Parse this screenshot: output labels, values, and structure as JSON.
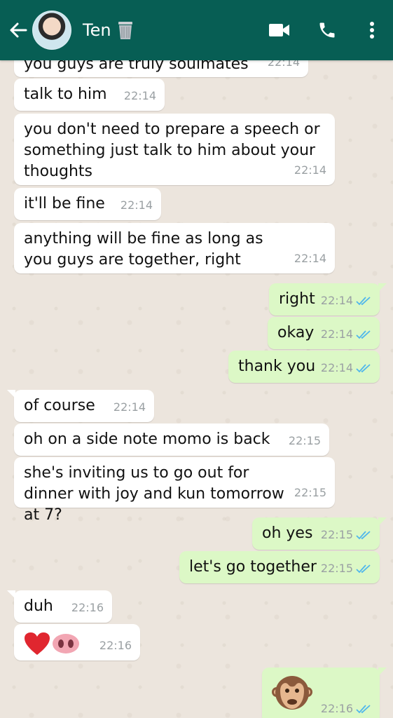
{
  "header": {
    "contact_name": "Ten",
    "name_emoji": "🗑️",
    "bar_color": "#075e54",
    "icons": [
      "back-arrow-icon",
      "video-call-icon",
      "phone-icon",
      "more-options-icon"
    ]
  },
  "colors": {
    "incoming_bubble": "#ffffff",
    "outgoing_bubble": "#dcf8c6",
    "read_ticks": "#4fb6ec",
    "chat_background": "#ece5dd"
  },
  "messages": [
    {
      "text": "you guys are truly soulmates",
      "time": "22:14",
      "dir": "in"
    },
    {
      "text": "talk to him",
      "time": "22:14",
      "dir": "in"
    },
    {
      "text": "you don't need to prepare a speech or something just talk to him about your thoughts",
      "time": "22:14",
      "dir": "in"
    },
    {
      "text": "it'll be fine",
      "time": "22:14",
      "dir": "in"
    },
    {
      "text": "anything will be fine as long as you guys are together, right",
      "time": "22:14",
      "dir": "in"
    },
    {
      "text": "right",
      "time": "22:14",
      "dir": "out"
    },
    {
      "text": "okay",
      "time": "22:14",
      "dir": "out"
    },
    {
      "text": "thank you",
      "time": "22:14",
      "dir": "out"
    },
    {
      "text": "of course",
      "time": "22:14",
      "dir": "in"
    },
    {
      "text": "oh on a side note momo is back",
      "time": "22:15",
      "dir": "in"
    },
    {
      "text": "she's inviting us to go out for dinner with joy and kun tomorrow at 7?",
      "time": "22:15",
      "dir": "in"
    },
    {
      "text": "oh yes",
      "time": "22:15",
      "dir": "out"
    },
    {
      "text": "let's go together",
      "time": "22:15",
      "dir": "out"
    },
    {
      "text": "duh",
      "time": "22:16",
      "dir": "in"
    },
    {
      "text": "",
      "emoji": [
        "red-heart-emoji",
        "pig-nose-emoji"
      ],
      "time": "22:16",
      "dir": "in"
    },
    {
      "text": "",
      "emoji": [
        "monkey-face-emoji"
      ],
      "time": "22:16",
      "dir": "out"
    }
  ]
}
